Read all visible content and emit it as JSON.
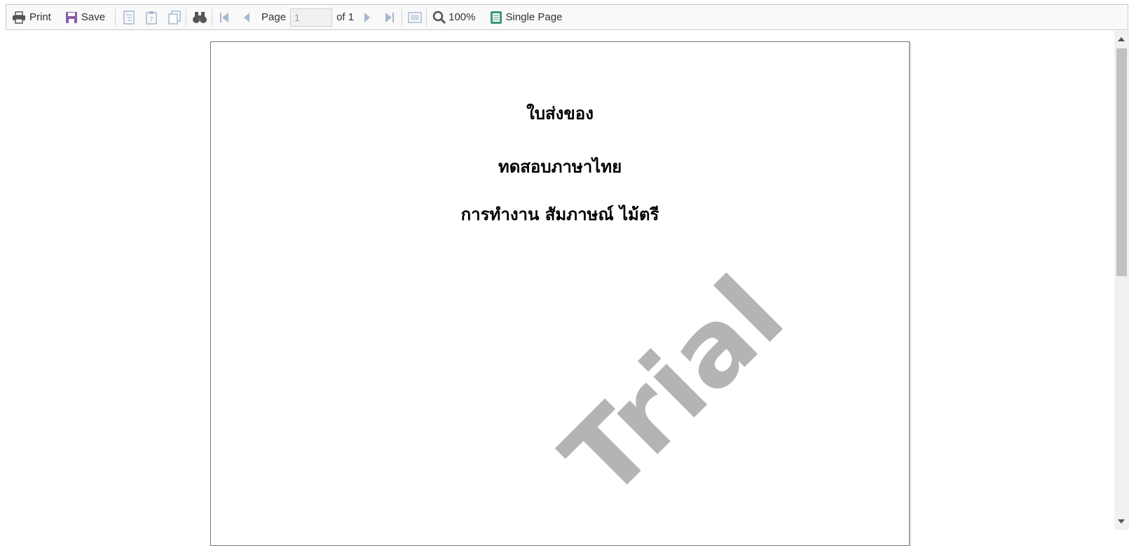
{
  "toolbar": {
    "print_label": "Print",
    "save_label": "Save",
    "page_label": "Page",
    "page_input_value": "1",
    "page_of": "of 1",
    "zoom": "100%",
    "view_mode": "Single Page"
  },
  "icons": {
    "print": "print-icon",
    "save": "save-icon",
    "bookmarks": "bookmarks-icon",
    "parameters": "parameters-icon",
    "resources": "resources-icon",
    "find": "find-binoculars-icon",
    "first_page": "first-page-icon",
    "prev_page": "prev-page-icon",
    "next_page": "next-page-icon",
    "last_page": "last-page-icon",
    "full_screen": "full-screen-icon",
    "zoom": "zoom-icon",
    "single_page": "single-page-icon"
  },
  "colors": {
    "save_icon": "#8a5da8",
    "disabled_icon": "#a6b8cc",
    "single_page_icon": "#3a9b77",
    "watermark": "#b4b4b4"
  },
  "document": {
    "line1": "ใบส่งของ",
    "line2": "ทดสอบภาษาไทย",
    "line3": "การทำงาน สัมภาษณ์ ไม้ตรี",
    "watermark": "Trial"
  }
}
